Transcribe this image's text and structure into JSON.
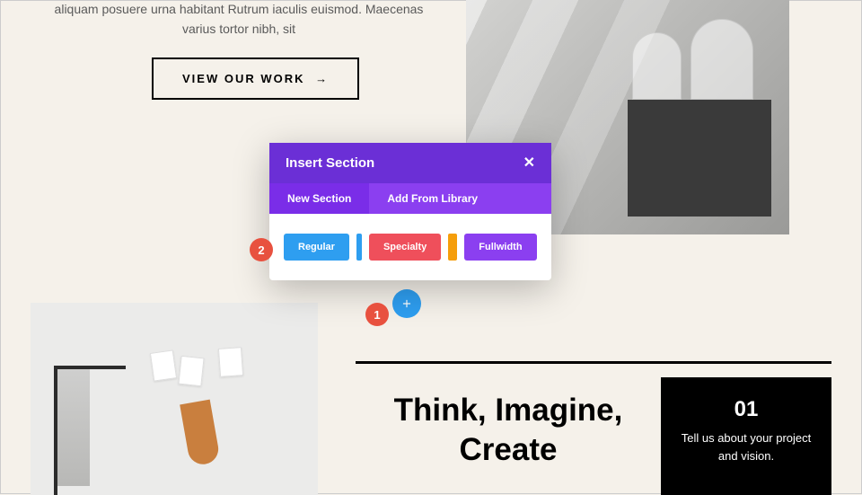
{
  "hero": {
    "paragraph": "aliquam posuere urna habitant Rutrum iaculis euismod. Maecenas varius tortor nibh, sit",
    "button_label": "VIEW OUR WORK"
  },
  "modal": {
    "title": "Insert Section",
    "tabs": {
      "new": "New Section",
      "library": "Add From Library"
    },
    "options": {
      "regular": "Regular",
      "specialty": "Specialty",
      "fullwidth": "Fullwidth"
    }
  },
  "annotations": {
    "one": "1",
    "two": "2"
  },
  "headline": "Think, Imagine, Create",
  "card": {
    "number": "01",
    "text": "Tell us about your project and vision."
  }
}
